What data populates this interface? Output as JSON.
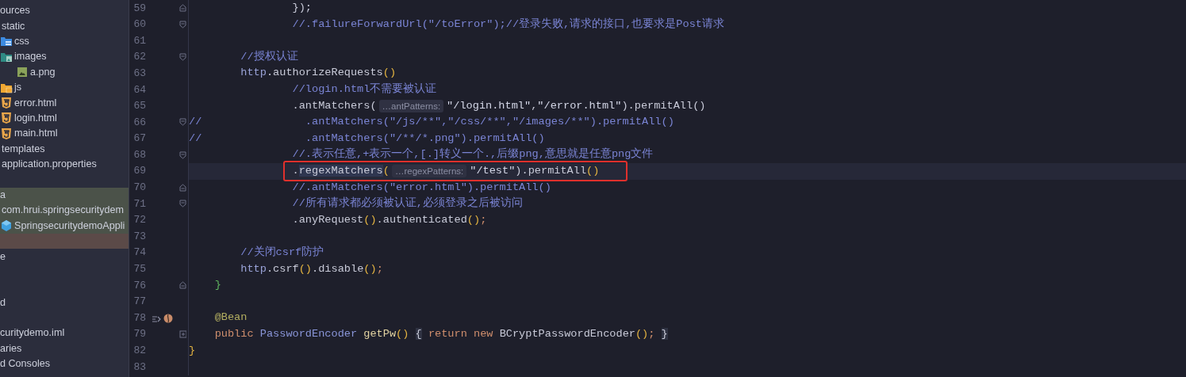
{
  "project_tree": [
    {
      "text": "ources",
      "children": [
        {
          "text": "static",
          "children": [
            {
              "text": "css",
              "kind": "css-folder"
            },
            {
              "text": "images",
              "kind": "image-folder",
              "children": [
                {
                  "text": "a.png",
                  "kind": "image"
                }
              ]
            },
            {
              "text": "js",
              "kind": "js-folder"
            },
            {
              "text": "error.html",
              "kind": "html"
            },
            {
              "text": "login.html",
              "kind": "html"
            },
            {
              "text": "main.html",
              "kind": "html"
            }
          ]
        },
        {
          "text": "templates"
        },
        {
          "text": "application.properties"
        }
      ]
    },
    {
      "kind": "blank"
    },
    {
      "text": "a",
      "color": "#4b5249",
      "children": [
        {
          "text": "com.hrui.springsecuritydem",
          "color": "#4b5249",
          "children": [
            {
              "text": "SpringsecuritydemoAppli",
              "kind": "class",
              "color": "#4b5249"
            }
          ]
        }
      ]
    },
    {
      "kind": "blank",
      "color": "#5b4a48"
    },
    {
      "text": "e"
    },
    {
      "kind": "blank"
    },
    {
      "kind": "blank"
    },
    {
      "text": "d"
    },
    {
      "kind": "blank"
    },
    {
      "text": "curitydemo.iml"
    },
    {
      "text": "aries"
    },
    {
      "text": "d Consoles"
    }
  ],
  "editor": {
    "lines": [
      {
        "number": "59",
        "fold_marker": {
          "kind": "end"
        },
        "tokens": [
          {
            "kind": "plain",
            "text": "                });"
          }
        ]
      },
      {
        "number": "60",
        "fold_marker": {
          "kind": "start"
        },
        "tokens": [
          {
            "kind": "comment",
            "text": "                //.failureForwardUrl(\"/toError\");//登录失败,请求的接口,也要求是Post请求"
          }
        ]
      },
      {
        "number": "61"
      },
      {
        "number": "62",
        "fold_marker": {
          "kind": "start"
        },
        "tokens": [
          {
            "kind": "comment",
            "text": "        //授权认证"
          }
        ]
      },
      {
        "number": "63",
        "tokens": [
          {
            "kind": "field",
            "text": "        http"
          },
          {
            "kind": "plain",
            "text": ".authorizeRequests"
          },
          {
            "kind": "paren",
            "text": "()"
          }
        ]
      },
      {
        "number": "64",
        "tokens": [
          {
            "kind": "comment",
            "text": "                //login.html不需要被认证"
          }
        ]
      },
      {
        "number": "65",
        "tokens": [
          {
            "kind": "plain",
            "text": "                .antMatchers("
          },
          {
            "kind": "hint",
            "text": "…antPatterns:"
          },
          {
            "kind": "string",
            "text": "\"/login.html\""
          },
          {
            "kind": "plain",
            "text": ","
          },
          {
            "kind": "string",
            "text": "\"/error.html\""
          },
          {
            "kind": "plain",
            "text": ").permitAll()"
          }
        ]
      },
      {
        "number": "66",
        "fold_marker": {
          "kind": "start"
        },
        "tokens": [
          {
            "kind": "comment",
            "text": "//                .antMatchers(\"/js/**\",\"/css/**\",\"/images/**\").permitAll()"
          }
        ]
      },
      {
        "number": "67",
        "tokens": [
          {
            "kind": "comment",
            "text": "//                .antMatchers(\"/**/*.png\").permitAll()"
          }
        ]
      },
      {
        "number": "68",
        "fold_marker": {
          "kind": "start"
        },
        "tokens": [
          {
            "kind": "comment",
            "text": "                //.表示任意,+表示一个,[.]转义一个.,后缀png,意思就是任意png文件"
          }
        ]
      },
      {
        "number": "69",
        "current": true,
        "boxed": true,
        "tokens": [
          {
            "kind": "plain",
            "text": "                ."
          },
          {
            "kind": "usage",
            "text": "regexMatchers"
          },
          {
            "kind": "paren",
            "text": "("
          },
          {
            "kind": "hint",
            "text": "…regexPatterns:"
          },
          {
            "kind": "string",
            "text": "\"/test\""
          },
          {
            "kind": "plain",
            "text": ").permitAll"
          },
          {
            "kind": "paren",
            "text": "()"
          }
        ]
      },
      {
        "number": "70",
        "fold_marker": {
          "kind": "end"
        },
        "tokens": [
          {
            "kind": "comment",
            "text": "                //.antMatchers(\"error.html\").permitAll()"
          }
        ]
      },
      {
        "number": "71",
        "fold_marker": {
          "kind": "start"
        },
        "tokens": [
          {
            "kind": "comment",
            "text": "                //所有请求都必须被认证,必须登录之后被访问"
          }
        ]
      },
      {
        "number": "72",
        "tokens": [
          {
            "kind": "plain",
            "text": "                .anyRequest"
          },
          {
            "kind": "paren",
            "text": "()"
          },
          {
            "kind": "plain",
            "text": ".authenticated"
          },
          {
            "kind": "paren",
            "text": "()"
          },
          {
            "kind": "semi",
            "text": ";"
          }
        ]
      },
      {
        "number": "73"
      },
      {
        "number": "74",
        "tokens": [
          {
            "kind": "comment",
            "text": "        //关闭csrf防护"
          }
        ]
      },
      {
        "number": "75",
        "tokens": [
          {
            "kind": "field",
            "text": "        http"
          },
          {
            "kind": "plain",
            "text": ".csrf"
          },
          {
            "kind": "paren",
            "text": "()"
          },
          {
            "kind": "plain",
            "text": ".disable"
          },
          {
            "kind": "paren",
            "text": "()"
          },
          {
            "kind": "semi",
            "text": ";"
          }
        ]
      },
      {
        "number": "76",
        "fold_marker": {
          "kind": "end"
        },
        "tokens": [
          {
            "kind": "brace_green",
            "text": "    }"
          }
        ]
      },
      {
        "number": "77"
      },
      {
        "number": "78",
        "gutter_icons": [
          {
            "kind": "implements"
          },
          {
            "kind": "bean"
          }
        ],
        "tokens": [
          {
            "kind": "annotation",
            "text": "    @Bean"
          }
        ]
      },
      {
        "number": "79",
        "fold_marker": {
          "kind": "expand"
        },
        "tokens": [
          {
            "kind": "keyword",
            "text": "    public "
          },
          {
            "kind": "type",
            "text": "PasswordEncoder "
          },
          {
            "kind": "method",
            "text": "getPw"
          },
          {
            "kind": "paren",
            "text": "() "
          },
          {
            "kind": "folded",
            "text": "{"
          },
          {
            "kind": "keyword",
            "text": " return new "
          },
          {
            "kind": "plain",
            "text": "BCryptPasswordEncoder"
          },
          {
            "kind": "paren",
            "text": "()"
          },
          {
            "kind": "semi",
            "text": "; "
          },
          {
            "kind": "folded",
            "text": "}"
          }
        ]
      },
      {
        "number": "82",
        "tokens": [
          {
            "kind": "brace_yellow",
            "text": "}"
          }
        ]
      },
      {
        "number": "83"
      }
    ]
  }
}
